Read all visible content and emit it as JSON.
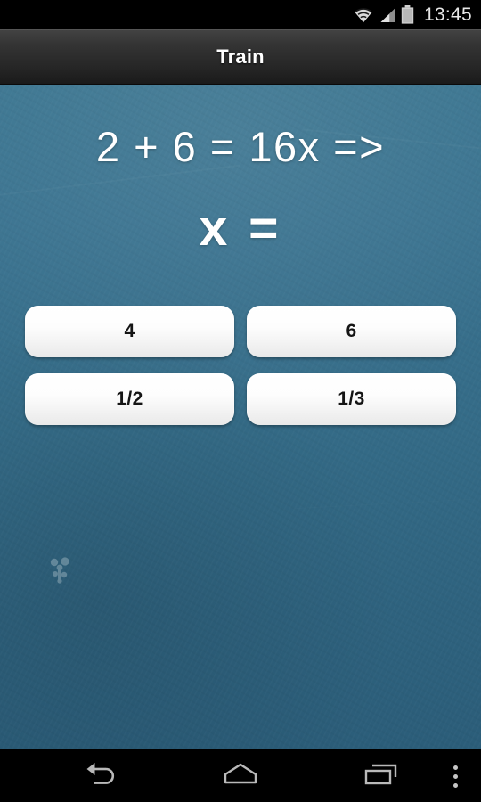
{
  "status_bar": {
    "time": "13:45",
    "icons": [
      "wifi-icon",
      "signal-icon",
      "battery-icon"
    ]
  },
  "app_bar": {
    "title": "Train"
  },
  "question": {
    "equation": "2 + 6 = 16x =>",
    "answer_prompt": "x ="
  },
  "options": [
    {
      "label": "4"
    },
    {
      "label": "6"
    },
    {
      "label": "1/2"
    },
    {
      "label": "1/3"
    }
  ],
  "nav_bar": {
    "back_label": "Back",
    "home_label": "Home",
    "recents_label": "Recent apps",
    "menu_label": "More options"
  },
  "colors": {
    "board_top": "#3c7691",
    "board_bottom": "#2b5d79",
    "app_bar_top": "#434343",
    "app_bar_bottom": "#1a1a1a",
    "button_face": "#ffffff",
    "button_text": "#151515",
    "chalk_text": "#ffffff",
    "nav_icon": "#c6c6c6",
    "status_text": "#e8e8e8"
  }
}
